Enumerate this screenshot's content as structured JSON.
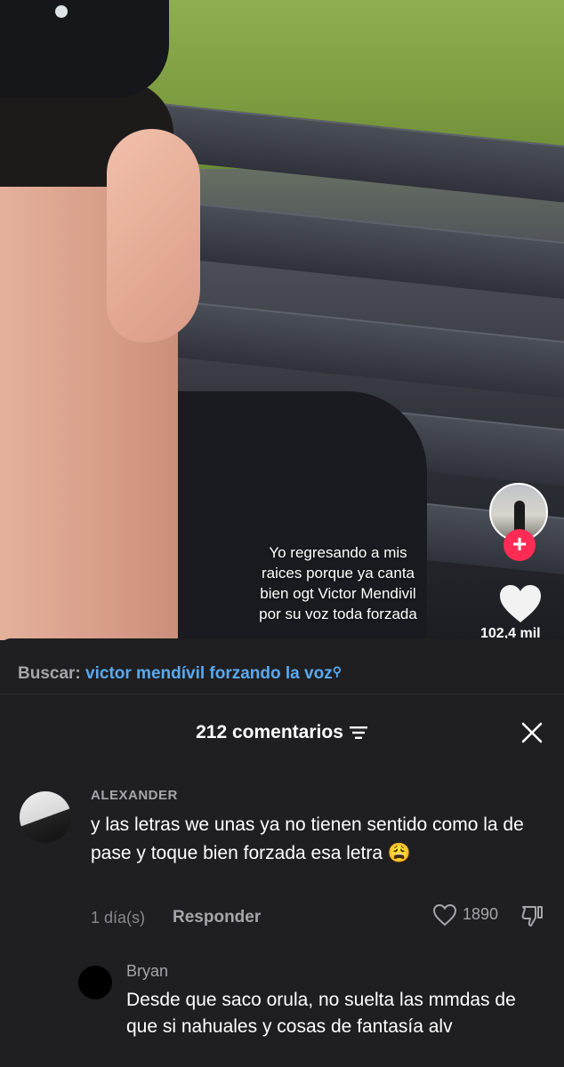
{
  "video": {
    "caption_lines": [
      "Yo regresando a mis",
      "raices porque ya canta",
      "bien ogt Victor Mendivil",
      "por su voz toda forzada"
    ],
    "like_count": "102,4 mil",
    "follow_symbol": "+"
  },
  "search": {
    "label": "Buscar:",
    "query": "victor mendívil forzando la voz",
    "icon": "search-icon"
  },
  "comments_header": {
    "title": "212 comentarios",
    "sort_icon": "sort-icon",
    "close_icon": "close-icon"
  },
  "comments": [
    {
      "user": "ALEXANDER",
      "text": "y las letras we unas ya no tienen sentido como la de pase y toque bien forzada esa letra 😩",
      "time": "1 día(s)",
      "reply_label": "Responder",
      "likes": "1890"
    },
    {
      "user": "Bryan",
      "text": "Desde que saco orula, no suelta las mmdas de que si nahuales y cosas de fantasía alv"
    }
  ],
  "colors": {
    "sheet_bg": "#1f1f21",
    "link_blue": "#5aa9ef",
    "follow_red": "#fe2c55",
    "muted_text": "#a6a6aa"
  }
}
